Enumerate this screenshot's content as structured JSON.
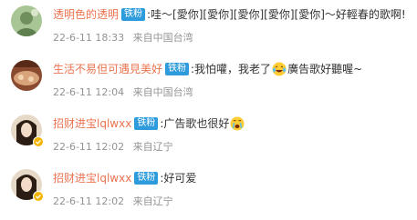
{
  "comments": [
    {
      "username": "透明色的透明",
      "badge": "铁粉",
      "text": ":哇～[愛你][愛你][愛你][愛你][愛你]～好輕春的歌啊!",
      "text_after_emoji": "",
      "emoji": "",
      "time": "22-6-11 18:33",
      "location": "来自中国台湾",
      "avatar_colors": [
        "#9fbf8c",
        "#5e7f4e"
      ],
      "verified": false
    },
    {
      "username": "生活不易但可遇見美好",
      "badge": "铁粉",
      "text": ":我怕嚾，我老了",
      "emoji": "laughing-tears-emoji",
      "text_after_emoji": "廣告歌好聽喔~",
      "time": "22-6-11 12:04",
      "location": "来自中国台湾",
      "avatar_colors": [
        "#d8a37a",
        "#7a3a24"
      ],
      "verified": false
    },
    {
      "username": "招财进宝lqlwxx",
      "badge": "铁粉",
      "text": ":广告歌也很好",
      "emoji": "crying-face-emoji",
      "text_after_emoji": "",
      "time": "22-6-11 12:02",
      "location": "来自辽宁",
      "avatar_colors": [
        "#e7d9c8",
        "#2b1d14"
      ],
      "verified": true
    },
    {
      "username": "招财进宝lqlwxx",
      "badge": "铁粉",
      "text": ":好可爱",
      "emoji": "",
      "text_after_emoji": "",
      "time": "22-6-11 12:02",
      "location": "来自辽宁",
      "avatar_colors": [
        "#e7d9c8",
        "#2b1d14"
      ],
      "verified": true
    }
  ],
  "colors": {
    "username": "#eb7350",
    "badge_bg": "#2e9bdc",
    "meta_text": "#939393",
    "verified": "#f4b400"
  }
}
